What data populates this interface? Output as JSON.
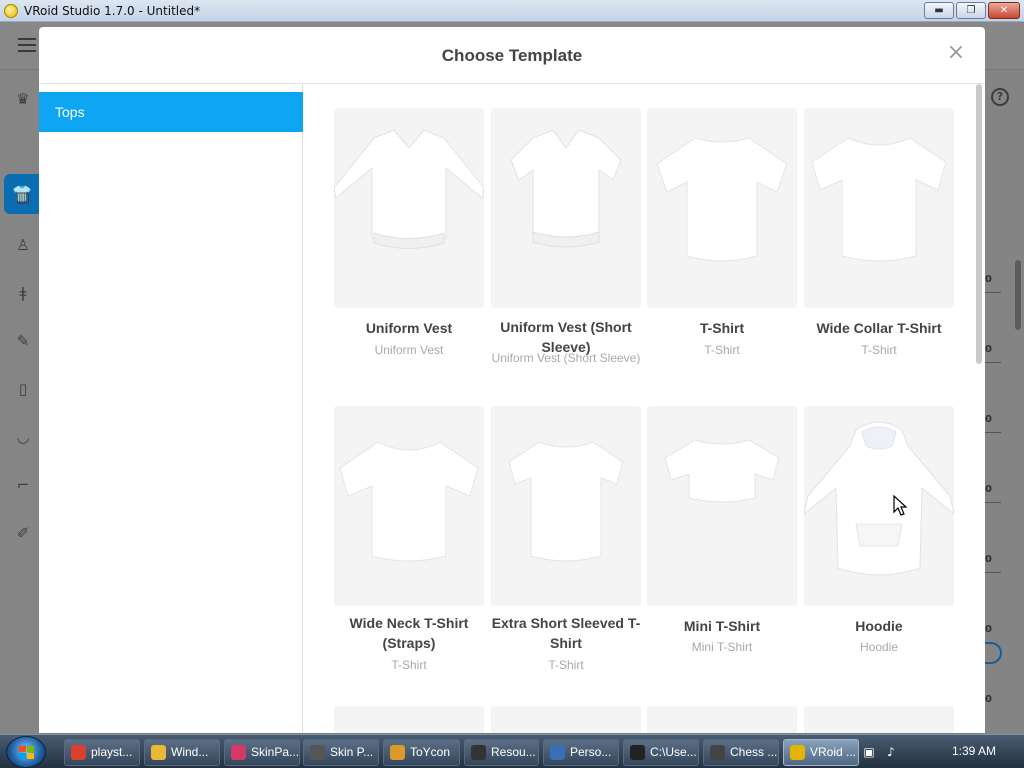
{
  "window": {
    "title": "VRoid Studio 1.7.0 - Untitled*",
    "minimize_glyph": "▬",
    "maximize_glyph": "❐",
    "close_glyph": "✕"
  },
  "app": {
    "rail_icons": [
      "shirt-icon",
      "hair-icon",
      "pants-icon",
      "dress-icon",
      "tie-icon",
      "brush-icon",
      "jacket-icon",
      "underwear-icon",
      "sock-icon",
      "shoe-icon"
    ],
    "help_glyph": "?",
    "right_ticks": [
      "0",
      "0",
      "0",
      "0",
      "0",
      "0",
      "0"
    ]
  },
  "modal": {
    "title": "Choose Template",
    "close_glyph": "×",
    "categories": [
      {
        "label": "Tops",
        "selected": true
      }
    ],
    "templates": [
      {
        "name": "Uniform Vest",
        "subtitle": "Uniform Vest"
      },
      {
        "name": "Uniform Vest (Short Sleeve)",
        "subtitle": "Uniform Vest (Short Sleeve)"
      },
      {
        "name": "T-Shirt",
        "subtitle": "T-Shirt"
      },
      {
        "name": "Wide Collar T-Shirt",
        "subtitle": "T-Shirt"
      },
      {
        "name": "Wide Neck T-Shirt (Straps)",
        "subtitle": "T-Shirt"
      },
      {
        "name": "Extra Short Sleeved T-Shirt",
        "subtitle": "T-Shirt"
      },
      {
        "name": "Mini T-Shirt",
        "subtitle": "Mini T-Shirt"
      },
      {
        "name": "Hoodie",
        "subtitle": "Hoodie"
      }
    ]
  },
  "taskbar": {
    "items": [
      {
        "label": "playst...",
        "icon": "chrome-icon",
        "color": "#d9412e"
      },
      {
        "label": "Wind...",
        "icon": "folder-icon",
        "color": "#e7b935"
      },
      {
        "label": "SkinPa...",
        "icon": "skinpack-icon",
        "color": "#d23a6a"
      },
      {
        "label": "Skin P...",
        "icon": "app-icon",
        "color": "#555555"
      },
      {
        "label": "ToYcon",
        "icon": "toycon-icon",
        "color": "#d99a2b"
      },
      {
        "label": "Resou...",
        "icon": "resource-icon",
        "color": "#333333"
      },
      {
        "label": "Perso...",
        "icon": "personalize-icon",
        "color": "#3a6fb5"
      },
      {
        "label": "C:\\Use...",
        "icon": "7zip-icon",
        "color": "#222222"
      },
      {
        "label": "Chess ...",
        "icon": "chess-icon",
        "color": "#444444"
      },
      {
        "label": "VRoid ...",
        "icon": "vroid-icon",
        "color": "#e2b400",
        "active": true
      }
    ],
    "clock": "1:39 AM"
  }
}
